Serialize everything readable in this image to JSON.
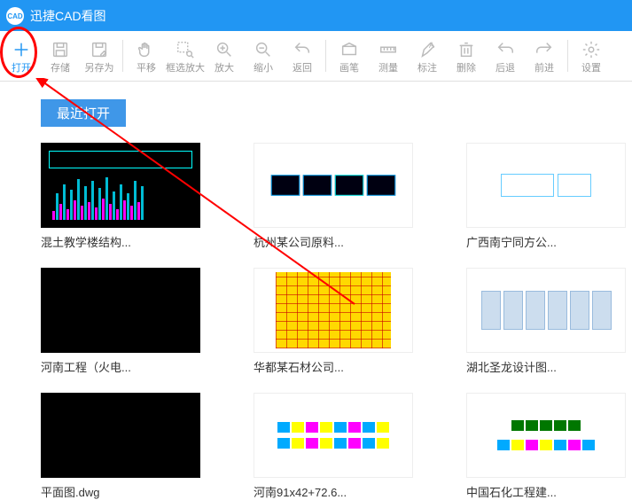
{
  "app": {
    "title": "迅捷CAD看图"
  },
  "toolbar": [
    {
      "id": "open",
      "label": "打开",
      "icon": "plus",
      "active": true
    },
    {
      "id": "save",
      "label": "存储",
      "icon": "save",
      "active": false
    },
    {
      "id": "saveas",
      "label": "另存为",
      "icon": "saveas",
      "active": false
    },
    {
      "sep": true
    },
    {
      "id": "pan",
      "label": "平移",
      "icon": "hand",
      "active": false
    },
    {
      "id": "zoombox",
      "label": "框选放大",
      "icon": "zoombox",
      "active": false
    },
    {
      "id": "zoomin",
      "label": "放大",
      "icon": "zoomin",
      "active": false
    },
    {
      "id": "zoomout",
      "label": "缩小",
      "icon": "zoomout",
      "active": false
    },
    {
      "id": "back",
      "label": "返回",
      "icon": "return",
      "active": false
    },
    {
      "sep": true
    },
    {
      "id": "draw",
      "label": "画笔",
      "icon": "draw",
      "active": false
    },
    {
      "id": "measure",
      "label": "测量",
      "icon": "measure",
      "active": false
    },
    {
      "id": "mark",
      "label": "标注",
      "icon": "mark",
      "active": false
    },
    {
      "id": "delete",
      "label": "删除",
      "icon": "delete",
      "active": false
    },
    {
      "id": "undo",
      "label": "后退",
      "icon": "undo",
      "active": false
    },
    {
      "id": "redo",
      "label": "前进",
      "icon": "redo",
      "active": false
    },
    {
      "sep": true
    },
    {
      "id": "settings",
      "label": "设置",
      "icon": "gear",
      "active": false
    }
  ],
  "section": {
    "header": "最近打开"
  },
  "files": [
    {
      "name": "混土教学楼结构...",
      "thumb": "black",
      "gfx": "bars1"
    },
    {
      "name": "杭州某公司原料...",
      "thumb": "white",
      "gfx": "plans"
    },
    {
      "name": "广西南宁同方公...",
      "thumb": "white",
      "gfx": "outline"
    },
    {
      "name": "河南工程（火电...",
      "thumb": "black",
      "gfx": "blank"
    },
    {
      "name": "华都某石材公司...",
      "thumb": "white",
      "gfx": "grid"
    },
    {
      "name": "湖北圣龙设计图...",
      "thumb": "white",
      "gfx": "docs"
    },
    {
      "name": "平面图.dwg",
      "thumb": "black",
      "gfx": "blank"
    },
    {
      "name": "河南91x42+72.6...",
      "thumb": "white",
      "gfx": "row"
    },
    {
      "name": "中国石化工程建...",
      "thumb": "white",
      "gfx": "row2"
    }
  ]
}
